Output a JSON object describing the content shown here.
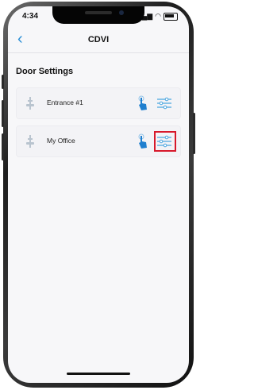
{
  "status_bar": {
    "time": "4:34",
    "signal": "▂▄▆",
    "wifi": "◠"
  },
  "nav": {
    "back_icon": "chevron-left-icon",
    "title": "CDVI"
  },
  "section": {
    "title": "Door Settings"
  },
  "doors": [
    {
      "label": "Entrance #1",
      "icon": "door-lock-icon",
      "highlighted": false
    },
    {
      "label": "My Office",
      "icon": "door-lock-icon",
      "highlighted": true
    }
  ],
  "colors": {
    "accent": "#2b8fd6",
    "highlight": "#d7192b",
    "background": "#f7f7f9"
  }
}
